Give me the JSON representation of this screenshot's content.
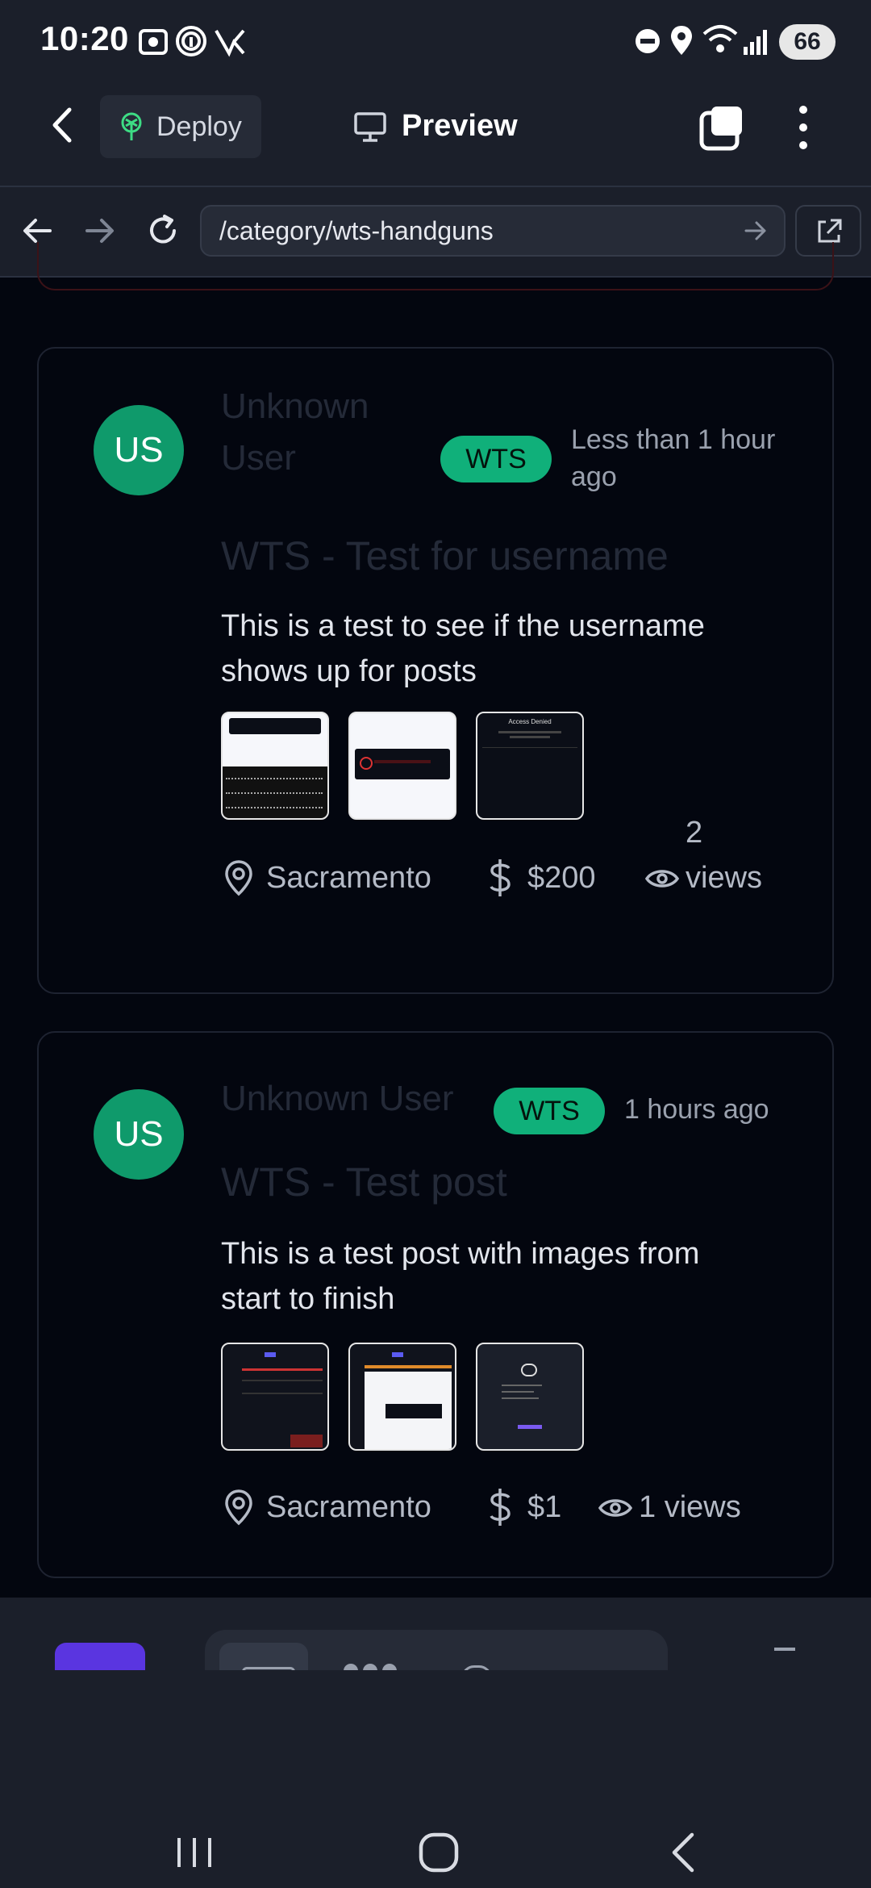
{
  "status_bar": {
    "time": "10:20",
    "battery": "66"
  },
  "app_bar": {
    "deploy_label": "Deploy",
    "preview_label": "Preview"
  },
  "browser": {
    "url": "/category/wts-handguns"
  },
  "posts": [
    {
      "avatar_initials": "US",
      "author_line1": "Unknown",
      "author_line2": "User",
      "badge": "WTS",
      "time_line1": "Less than 1 hour",
      "time_line2": "ago",
      "title": "WTS - Test for username",
      "description_line1": "This is a test to see if the username",
      "description_line2": "shows up for posts",
      "location": "Sacramento",
      "price": "$200",
      "views_line1": "2",
      "views_line2": "views"
    },
    {
      "avatar_initials": "US",
      "author": "Unknown User",
      "badge": "WTS",
      "time": "1 hours ago",
      "title": "WTS - Test post",
      "description_line1": "This is a test post with images from",
      "description_line2": "start to finish",
      "location": "Sacramento",
      "price": "$1",
      "views": "1 views"
    }
  ],
  "thumbnail_texts": {
    "access_denied": "Access Denied"
  },
  "colors": {
    "badge": "#10b07a",
    "avatar": "#0f9a6b",
    "background": "#03060f",
    "bar": "#1b1f2a"
  }
}
